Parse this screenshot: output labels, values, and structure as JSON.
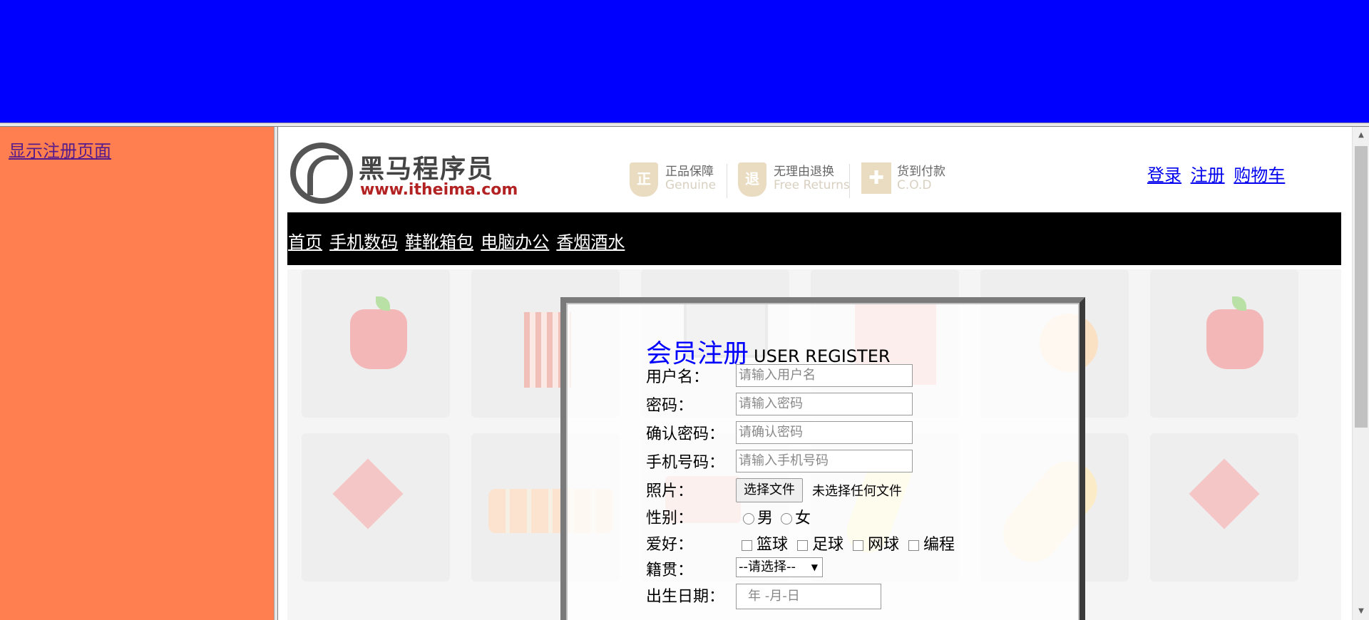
{
  "left_frame": {
    "link_label": "显示注册页面"
  },
  "header": {
    "logo_title": "黑马程序员",
    "logo_url": "www.itheima.com",
    "badges": [
      {
        "icon": "genuine-shield-icon",
        "glyph": "正",
        "cn": "正品保障",
        "en": "Genuine"
      },
      {
        "icon": "returns-shield-icon",
        "glyph": "退",
        "cn": "无理由退换",
        "en": "Free Returns"
      },
      {
        "icon": "gift-box-icon",
        "glyph": "✚",
        "cn": "货到付款",
        "en": "C.O.D"
      }
    ],
    "links": [
      "登录",
      "注册",
      "购物车"
    ]
  },
  "nav": {
    "items": [
      "首页",
      "手机数码",
      "鞋靴箱包",
      "电脑办公",
      "香烟酒水"
    ]
  },
  "form": {
    "title_cn": "会员注册",
    "title_en": "USER REGISTER",
    "username_label": "用户名：",
    "username_placeholder": "请输入用户名",
    "password_label": "密码：",
    "password_placeholder": "请输入密码",
    "confirm_label": "确认密码：",
    "confirm_placeholder": "请确认密码",
    "phone_label": "手机号码：",
    "phone_placeholder": "请输入手机号码",
    "photo_label": "照片：",
    "file_button": "选择文件",
    "file_status": "未选择任何文件",
    "gender_label": "性别：",
    "gender_options": [
      "男",
      "女"
    ],
    "hobby_label": "爱好：",
    "hobby_options": [
      "篮球",
      "足球",
      "网球",
      "编程"
    ],
    "origin_label": "籍贯：",
    "origin_selected": "--请选择--",
    "birthday_label": "出生日期：",
    "birthday_placeholder": "年 -月-日"
  },
  "colors": {
    "top_frame": "#0000ff",
    "left_frame": "#ff7f50",
    "nav_bg": "#000000",
    "title_accent": "#0000ff"
  }
}
